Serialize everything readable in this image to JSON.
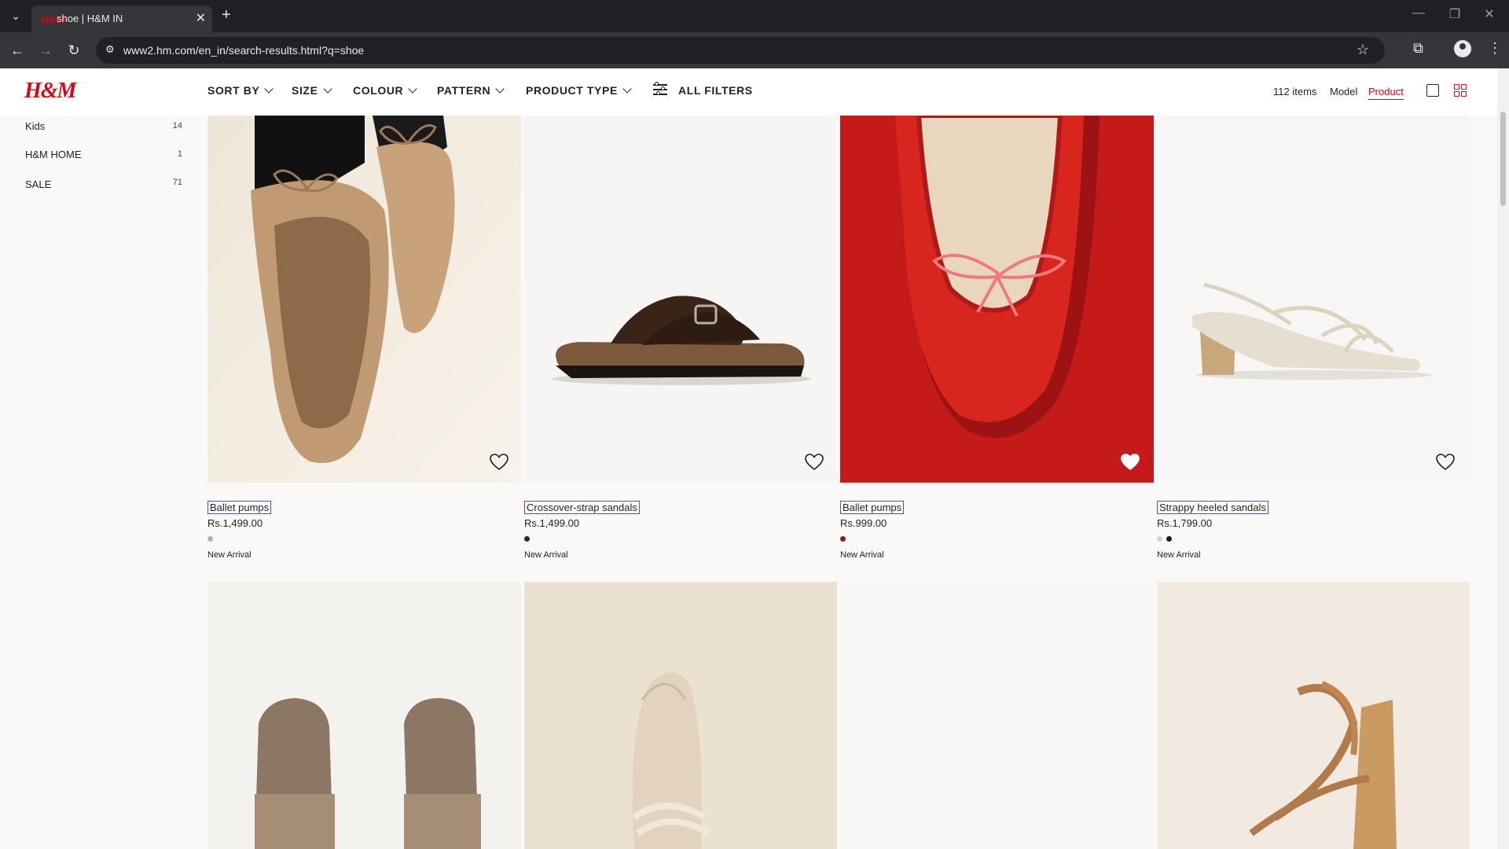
{
  "browser": {
    "tab_title": "shoe | H&M IN",
    "tab_favicon": "H&M",
    "url": "www2.hm.com/en_in/search-results.html?q=shoe"
  },
  "header": {
    "logo": "H&M",
    "brand_color": "#e50010",
    "filters": [
      "SORT BY",
      "SIZE",
      "COLOUR",
      "PATTERN",
      "PRODUCT TYPE"
    ],
    "all_filters": "ALL FILTERS",
    "items_count": "112 items",
    "view_model": "Model",
    "view_product": "Product"
  },
  "sidebar": {
    "items": [
      {
        "label": "Kids",
        "count": "14"
      },
      {
        "label": "H&M HOME",
        "count": "1"
      },
      {
        "label": "SALE",
        "count": "71"
      }
    ]
  },
  "products": [
    {
      "name": "Ballet pumps",
      "price": "Rs.1,499.00",
      "badge": "New Arrival",
      "swatches": [
        "#b9b2a8"
      ],
      "favourite": false
    },
    {
      "name": "Crossover-strap sandals",
      "price": "Rs.1,499.00",
      "badge": "New Arrival",
      "swatches": [
        "#3a2418"
      ],
      "favourite": false
    },
    {
      "name": "Ballet pumps",
      "price": "Rs.999.00",
      "badge": "New Arrival",
      "swatches": [
        "#8b1a1a"
      ],
      "favourite": false
    },
    {
      "name": "Strappy heeled sandals",
      "price": "Rs.1,799.00",
      "badge": "New Arrival",
      "swatches": [
        "#d8d2c4",
        "#1a1a1a"
      ],
      "favourite": false
    }
  ]
}
